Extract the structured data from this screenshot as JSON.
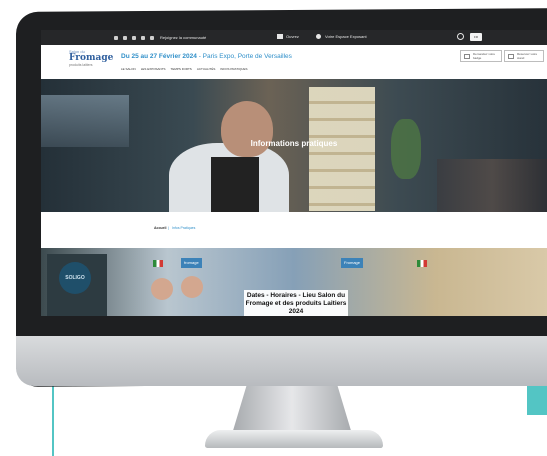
{
  "topbar": {
    "join_label": "Rejoignez la communauté",
    "ticket_label": "Ouvrez",
    "exhibitor_space_label": "Votre Espace Exposant",
    "language_label": "FR"
  },
  "header": {
    "logo_line1": "Salon du",
    "logo_name": "Fromage",
    "logo_line3": "produits laitiers",
    "dates_bold": "Du 25 au 27 Février 2024",
    "dates_rest": " - Paris Expo, Porte de Versailles",
    "nav": [
      "LE SALON",
      "LES EXPOSANTS",
      "TEMPS FORTS",
      "ACTUALITÉS",
      "INFOS PRATIQUES"
    ],
    "button1_label": "Demandez votre badge",
    "button2_label": "Réservez votre stand"
  },
  "hero": {
    "title": "Informations pratiques"
  },
  "breadcrumb": {
    "home": "Accueil",
    "separator": "|",
    "current": "Infos Pratiques"
  },
  "lower": {
    "soligo": "SOLIGO",
    "sign1": "fromage",
    "sign2": "Fromage",
    "card_title": "Dates - Horaires - Lieu Salon du Fromage et des produits Laitiers 2024"
  }
}
